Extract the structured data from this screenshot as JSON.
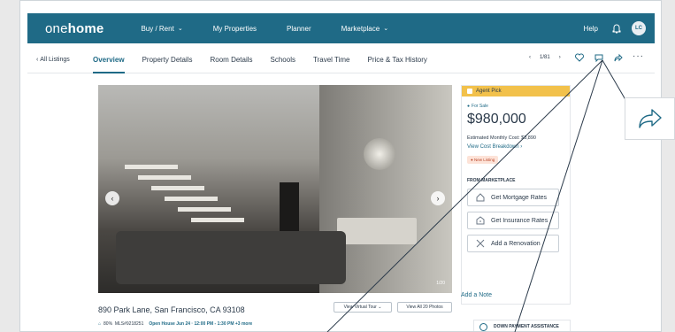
{
  "nav": {
    "logo_pre": "one",
    "logo_bold": "home",
    "items": [
      "Buy / Rent",
      "My Properties",
      "Planner",
      "Marketplace"
    ],
    "help": "Help",
    "avatar": "LC"
  },
  "subnav": {
    "back": "All Listings",
    "tabs": [
      "Overview",
      "Property Details",
      "Room Details",
      "Schools",
      "Travel Time",
      "Price & Tax History"
    ],
    "pager": "1/81"
  },
  "photo": {
    "counter": "1/20"
  },
  "listing": {
    "address": "890 Park Lane, San Francisco, CA 93108",
    "match": "80%",
    "mls": "MLS#9218251",
    "open_house": "Open House Jun 24 · 12:00 PM - 1:30 PM +3 more",
    "virtual_tour": "View Virtual Tour",
    "view_photos": "View All 20 Photos"
  },
  "panel": {
    "badge": "Agent Pick",
    "status": "For Sale",
    "price": "$980,000",
    "monthly": "Estimated Monthly Cost: $3,890",
    "breakdown": "View Cost Breakdown",
    "new_listing": "New Listing",
    "marketplace": "FROM MARKETPLACE",
    "buttons": [
      "Get Mortgage Rates",
      "Get Insurance Rates",
      "Add a Renovation"
    ],
    "add_note": "Add a Note",
    "down_payment": "DOWN PAYMENT ASSISTANCE"
  },
  "colors": {
    "brand": "#1f6a86",
    "agent_pick": "#f2c14b"
  },
  "icons": [
    "bell-icon",
    "heart-icon",
    "comment-icon",
    "share-icon",
    "more-icon"
  ]
}
